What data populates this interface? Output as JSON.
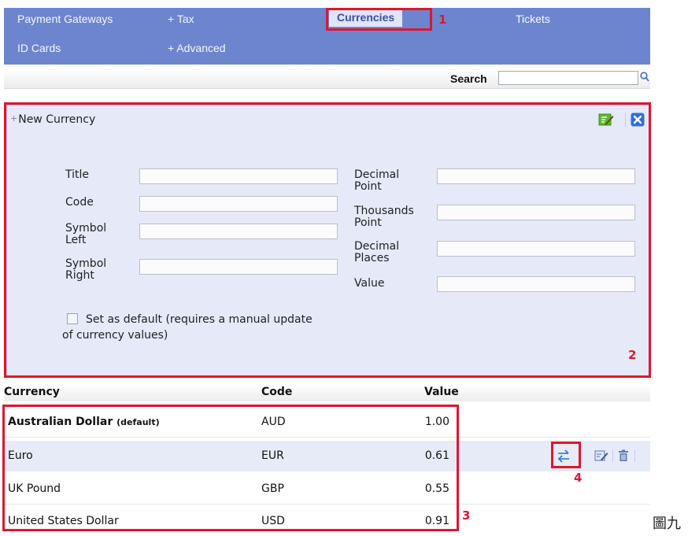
{
  "nav": {
    "items": [
      {
        "label": "Payment Gateways"
      },
      {
        "label": "+ Tax"
      },
      {
        "label": "Currencies",
        "active": true
      },
      {
        "label": "Tickets"
      },
      {
        "label": "ID Cards"
      },
      {
        "label": "+ Advanced"
      }
    ]
  },
  "search": {
    "label": "Search",
    "value": "",
    "icon": "magnifier-icon"
  },
  "panel": {
    "title": "New Currency",
    "icons": [
      "save-icon",
      "close-icon"
    ],
    "fields": {
      "title": {
        "label": "Title",
        "value": ""
      },
      "code": {
        "label": "Code",
        "value": ""
      },
      "symbol_left": {
        "label": "Symbol Left",
        "value": ""
      },
      "symbol_right": {
        "label": "Symbol Right",
        "value": ""
      },
      "decimal_point": {
        "label": "Decimal Point",
        "value": ""
      },
      "thousands_point": {
        "label": "Thousands Point",
        "value": ""
      },
      "decimal_places": {
        "label": "Decimal Places",
        "value": ""
      },
      "value": {
        "label": "Value",
        "value": ""
      }
    },
    "default_checkbox": {
      "label": "Set as default (requires a manual update of currency values)",
      "checked": false
    }
  },
  "table": {
    "headers": {
      "currency": "Currency",
      "code": "Code",
      "value": "Value"
    },
    "rows": [
      {
        "currency": "Australian Dollar",
        "note": "(default)",
        "code": "AUD",
        "value": "1.00"
      },
      {
        "currency": "Euro",
        "note": "",
        "code": "EUR",
        "value": "0.61"
      },
      {
        "currency": "UK Pound",
        "note": "",
        "code": "GBP",
        "value": "0.55"
      },
      {
        "currency": "United States Dollar",
        "note": "",
        "code": "USD",
        "value": "0.91"
      }
    ],
    "row_actions": [
      "update-rate-icon",
      "edit-icon",
      "delete-icon"
    ]
  },
  "annotations": [
    "1",
    "2",
    "3",
    "4"
  ],
  "side_text": "圖九",
  "colors": {
    "nav_bg": "#6d85cf",
    "panel_bg": "#e5e9f8",
    "annotation": "#e0162b",
    "selected_row": "#e7ebf7"
  }
}
